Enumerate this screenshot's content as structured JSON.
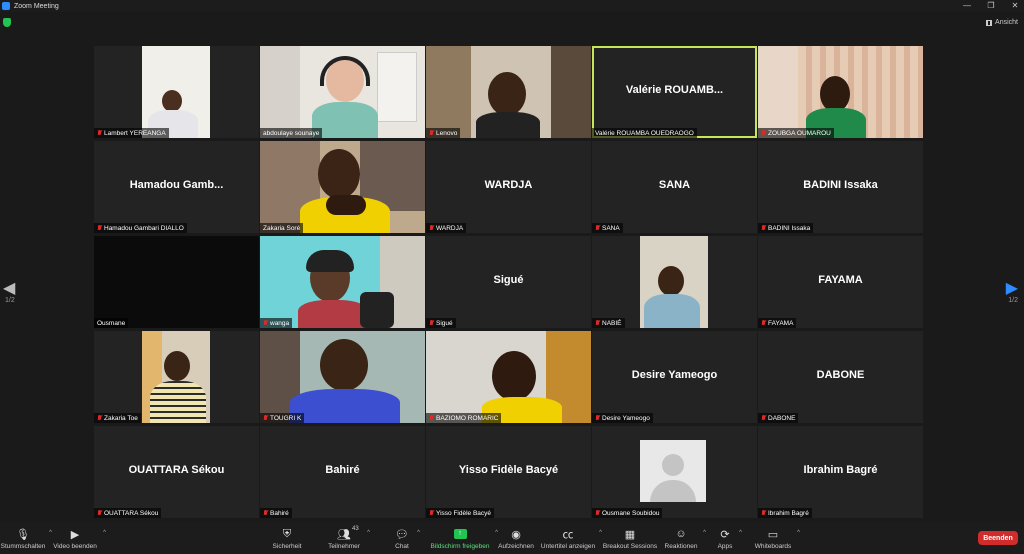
{
  "window": {
    "title": "Zoom Meeting",
    "controls": [
      "—",
      "❐",
      "✕"
    ]
  },
  "view_button": {
    "label": "Ansicht"
  },
  "pagination": {
    "left": "1/2",
    "right": "1/2"
  },
  "tiles": [
    {
      "label": "Lambert YEREANGA",
      "kind": "video",
      "muted": true
    },
    {
      "label": "abdoulaye sounaye",
      "kind": "video",
      "muted": false
    },
    {
      "label": "Lenovo",
      "kind": "video",
      "muted": true
    },
    {
      "label": "Valérie ROUAMBA OUEDRAOGO",
      "bigname": "Valérie  ROUAMB...",
      "kind": "name",
      "muted": false,
      "active": true
    },
    {
      "label": "ZOUBGA OUMAROU",
      "kind": "video",
      "muted": true
    },
    {
      "label": "Hamadou Gambari DIALLO",
      "bigname": "Hamadou  Gamb...",
      "kind": "name",
      "muted": true
    },
    {
      "label": "Zakaria Soré",
      "kind": "video",
      "muted": false
    },
    {
      "label": "WARDJA",
      "bigname": "WARDJA",
      "kind": "name",
      "muted": true
    },
    {
      "label": "SANA",
      "bigname": "SANA",
      "kind": "name",
      "muted": true
    },
    {
      "label": "BADINI Issaka",
      "bigname": "BADINI Issaka",
      "kind": "name",
      "muted": true
    },
    {
      "label": "Ousmane",
      "kind": "black",
      "muted": false
    },
    {
      "label": "wanga",
      "kind": "video",
      "muted": true
    },
    {
      "label": "Sigué",
      "bigname": "Sigué",
      "kind": "name",
      "muted": true
    },
    {
      "label": "NABIÉ",
      "kind": "video",
      "muted": true
    },
    {
      "label": "FAYAMA",
      "bigname": "FAYAMA",
      "kind": "name",
      "muted": true
    },
    {
      "label": "Zakaria Toe",
      "kind": "video",
      "muted": true
    },
    {
      "label": "TOUGRI K",
      "kind": "video",
      "muted": true
    },
    {
      "label": "BAZIOMO ROMARIC",
      "kind": "video",
      "muted": true
    },
    {
      "label": "Desire Yameogo",
      "bigname": "Desire Yameogo",
      "kind": "name",
      "muted": true
    },
    {
      "label": "DABONE",
      "bigname": "DABONE",
      "kind": "name",
      "muted": true
    },
    {
      "label": "OUATTARA Sékou",
      "bigname": "OUATTARA Sékou",
      "kind": "name",
      "muted": true
    },
    {
      "label": "Bahiré",
      "bigname": "Bahiré",
      "kind": "name",
      "muted": true
    },
    {
      "label": "Yisso Fidèle Bacyé",
      "bigname": "Yisso Fidèle Bacyé",
      "kind": "name",
      "muted": true
    },
    {
      "label": "Ousmane Soubidou",
      "kind": "avatar",
      "muted": true
    },
    {
      "label": "Ibrahim Bagré",
      "bigname": "Ibrahim Bagré",
      "kind": "name",
      "muted": true
    }
  ],
  "toolbar": {
    "mute": "Stummschalten",
    "video": "Video beenden",
    "security": "Sicherheit",
    "participants": "Teilnehmer",
    "participants_count": "43",
    "chat": "Chat",
    "share": "Bildschirm freigeben",
    "record": "Aufzeichnen",
    "captions": "Untertitel anzeigen",
    "breakout": "Breakout Sessions",
    "reactions": "Reaktionen",
    "apps": "Apps",
    "whiteboards": "Whiteboards",
    "end": "Beenden"
  },
  "colors": {
    "active_speaker": "#c8e45a",
    "share_green": "#23c552",
    "end_red": "#d12c2c",
    "accent_blue": "#2d8cff"
  }
}
